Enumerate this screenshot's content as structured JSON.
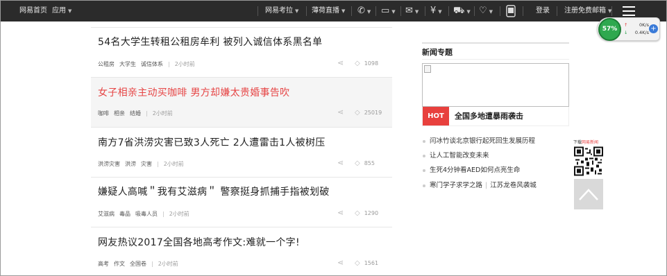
{
  "topbar": {
    "home": "网易首页",
    "apps": "应用",
    "kaola": "网易考拉",
    "huajie": "薄荷直播",
    "login": "登录",
    "register": "注册免费邮箱"
  },
  "news": [
    {
      "title": "54名大学生转租公租房牟利 被列入诚信体系黑名单",
      "tags": [
        "公租房",
        "大学生",
        "诚信体系"
      ],
      "time": "2小时前",
      "count": "1098",
      "highlight": false
    },
    {
      "title": "女子相亲主动买咖啡 男方却嫌太贵婚事告吹",
      "tags": [
        "咖啡",
        "相亲",
        "结婚"
      ],
      "time": "2小时前",
      "count": "25019",
      "highlight": true
    },
    {
      "title": "南方7省洪涝灾害已致3人死亡 2人遭雷击1人被树压",
      "tags": [
        "洪涝灾害",
        "洪涝",
        "灾害"
      ],
      "time": "2小时前",
      "count": "855",
      "highlight": false
    },
    {
      "title": "嫌疑人高喊＂我有艾滋病＂ 警察挺身抓捕手指被划破",
      "tags": [
        "艾滋病",
        "毒品",
        "吸毒人员"
      ],
      "time": "2小时前",
      "count": "1290",
      "highlight": false
    },
    {
      "title": "网友热议2017全国各地高考作文:难就一个字!",
      "tags": [
        "高考",
        "作文",
        "全国卷"
      ],
      "time": "2小时前",
      "count": "1561",
      "highlight": false
    }
  ],
  "sidebar": {
    "title": "新闻专题",
    "hot_tag": "HOT",
    "hot_text": "全国多地遭暴雨袭击",
    "links": [
      [
        "闫冰竹谈北京银行起死回生发展历程"
      ],
      [
        "让人工智能改变未来"
      ],
      [
        "生死4分钟看AED如何点亮生命"
      ],
      [
        "寒门学子求学之路",
        "江苏龙卷风袭城"
      ]
    ]
  },
  "qr": {
    "label_prefix": "下载",
    "label_brand": "网易新闻"
  },
  "widget": {
    "percent": "57%",
    "up": "0K/s",
    "down": "0.4K/s"
  },
  "colors": {
    "topbar": "#2b2b2b",
    "accent": "#e64545",
    "hot": "#e8403d",
    "widget_green": "#2fa84f"
  }
}
